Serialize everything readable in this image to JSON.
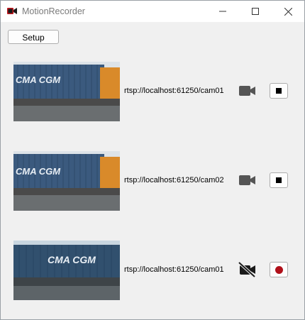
{
  "window": {
    "title": "MotionRecorder",
    "icons": {
      "app": "camera-red-icon",
      "minimize": "minimize-icon",
      "maximize": "maximize-icon",
      "close": "close-icon"
    }
  },
  "toolbar": {
    "setup_label": "Setup"
  },
  "cameras": [
    {
      "thumbnail_text": "CMA CGM",
      "url": "rtsp://localhost:61250/cam01",
      "status_icon": "video-camera-icon",
      "action": "stop",
      "action_icon": "stop-square-icon"
    },
    {
      "thumbnail_text": "CMA CGM",
      "url": "rtsp://localhost:61250/cam02",
      "status_icon": "video-camera-icon",
      "action": "stop",
      "action_icon": "stop-square-icon"
    },
    {
      "thumbnail_text": "CMA CGM",
      "url": "rtsp://localhost:61250/cam01",
      "status_icon": "video-camera-off-icon",
      "action": "record",
      "action_icon": "record-dot-icon"
    }
  ],
  "colors": {
    "record": "#b0101a",
    "camera_icon": "#555555",
    "container_blue": "#3b5a7e"
  }
}
